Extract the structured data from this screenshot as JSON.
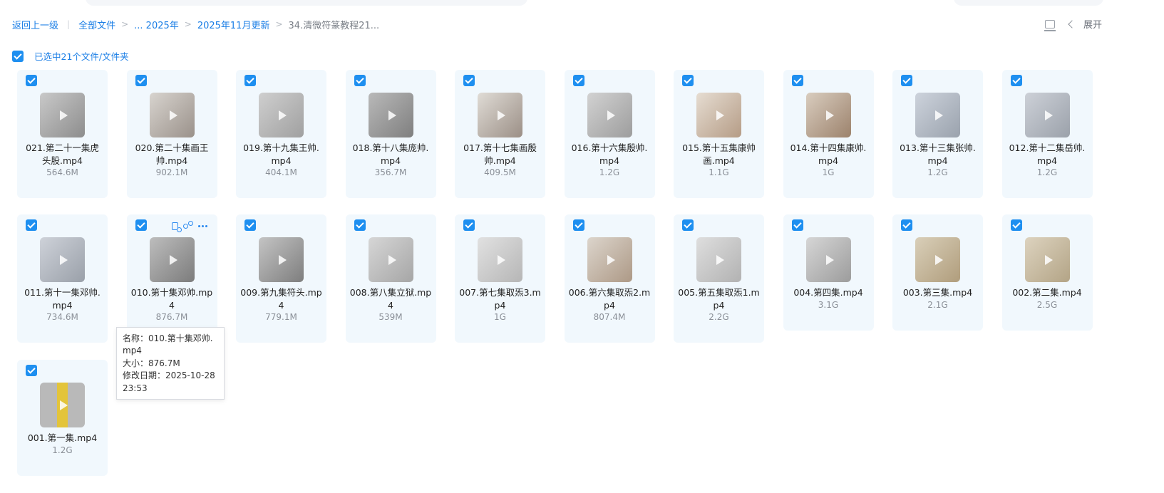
{
  "breadcrumb": {
    "back": "返回上一级",
    "all_files": "全部文件",
    "ellipsis_year": "... 2025年",
    "month": "2025年11月更新",
    "current": "34.清微符篆教程21..."
  },
  "toolbar": {
    "expand_label": "展开"
  },
  "selection": {
    "label": "已选中21个文件/文件夹"
  },
  "colors": {
    "accent": "#1e8ff0",
    "card_bg": "#f1f8fd"
  },
  "files": [
    {
      "name": "021.第二十一集虎头股.mp4",
      "size": "564.6M"
    },
    {
      "name": "020.第二十集画王帅.mp4",
      "size": "902.1M"
    },
    {
      "name": "019.第十九集王帅.mp4",
      "size": "404.1M"
    },
    {
      "name": "018.第十八集庞帅.mp4",
      "size": "356.7M"
    },
    {
      "name": "017.第十七集画殷帅.mp4",
      "size": "409.5M"
    },
    {
      "name": "016.第十六集殷帅.mp4",
      "size": "1.2G"
    },
    {
      "name": "015.第十五集康帅画.mp4",
      "size": "1.1G"
    },
    {
      "name": "014.第十四集康帅.mp4",
      "size": "1G"
    },
    {
      "name": "013.第十三集张帅.mp4",
      "size": "1.2G"
    },
    {
      "name": "012.第十二集岳帅.mp4",
      "size": "1.2G"
    },
    {
      "name": "011.第十一集邓帅.mp4",
      "size": "734.6M"
    },
    {
      "name": "010.第十集邓帅.mp4",
      "size": "876.7M"
    },
    {
      "name": "009.第九集符头.mp4",
      "size": "779.1M"
    },
    {
      "name": "008.第八集立狱.mp4",
      "size": "539M"
    },
    {
      "name": "007.第七集取炁3.mp4",
      "size": "1G"
    },
    {
      "name": "006.第六集取炁2.mp4",
      "size": "807.4M"
    },
    {
      "name": "005.第五集取炁1.mp4",
      "size": "2.2G"
    },
    {
      "name": "004.第四集.mp4",
      "size": "3.1G"
    },
    {
      "name": "003.第三集.mp4",
      "size": "2.1G"
    },
    {
      "name": "002.第二集.mp4",
      "size": "2.5G"
    },
    {
      "name": "001.第一集.mp4",
      "size": "1.2G"
    }
  ],
  "tooltip": {
    "name_line": "名称：010.第十集邓帅.mp4",
    "size_line": "大小：876.7M",
    "date_line": "修改日期：2025-10-28 23:53"
  }
}
